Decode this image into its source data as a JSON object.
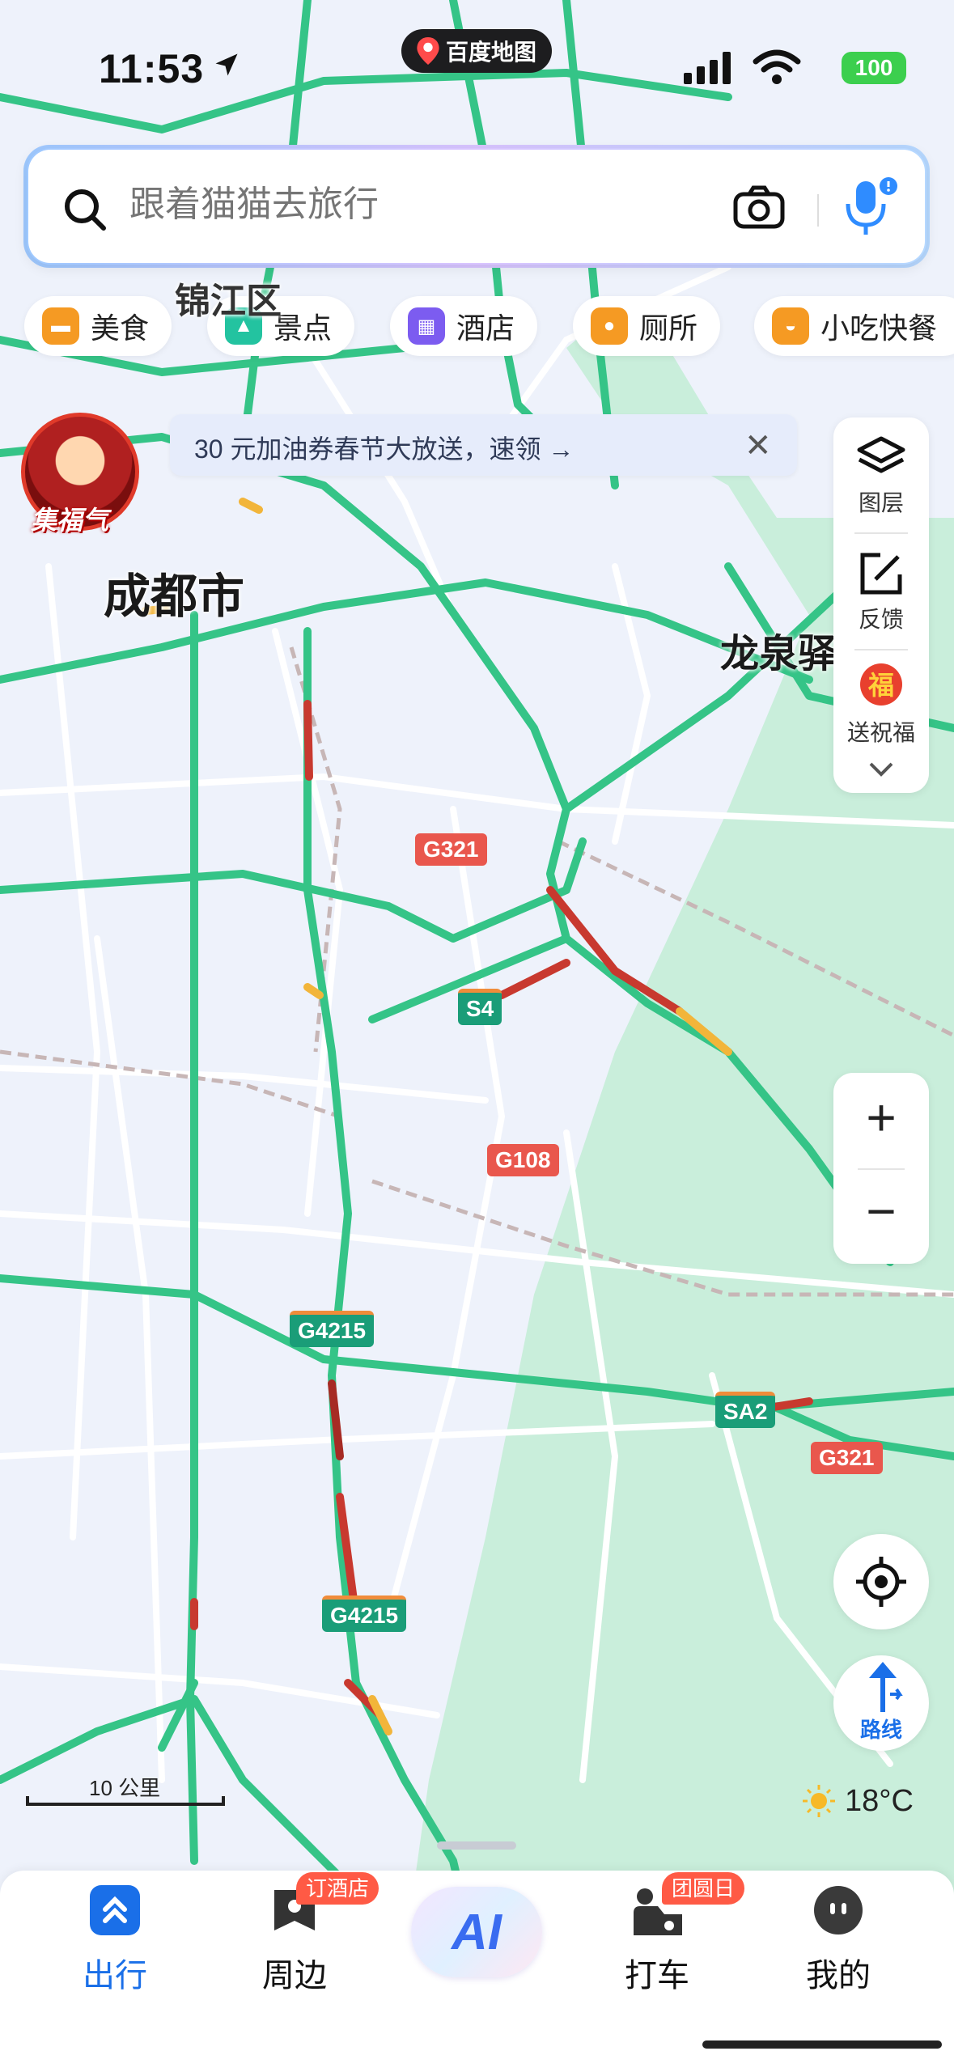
{
  "status": {
    "time": "11:53",
    "app_name": "百度地图",
    "battery": "100"
  },
  "search": {
    "placeholder": "跟着猫猫去旅行"
  },
  "categories": [
    {
      "label": "美食",
      "icon": "food-icon",
      "color": "#f59a23"
    },
    {
      "label": "景点",
      "icon": "scenic-icon",
      "color": "#23c3a0"
    },
    {
      "label": "酒店",
      "icon": "hotel-icon",
      "color": "#7c5cf0"
    },
    {
      "label": "厕所",
      "icon": "toilet-icon",
      "color": "#f59a23"
    },
    {
      "label": "小吃快餐",
      "icon": "snack-icon",
      "color": "#f59a23"
    }
  ],
  "promo": {
    "text": "30 元加油券春节大放送，速领 →",
    "close": "✕"
  },
  "avatar": {
    "label": "集福气"
  },
  "map": {
    "labels": {
      "city": "成都市",
      "district": "锦江区",
      "town": "龙泉驿"
    },
    "shields": {
      "g321_a": "G321",
      "s4": "S4",
      "g108": "G108",
      "g4215_a": "G4215",
      "sa2": "SA2",
      "g321_b": "G321",
      "g4215_b": "G4215"
    }
  },
  "tools": {
    "layers": "图层",
    "feedback": "反馈",
    "blessing": "送祝福"
  },
  "zoom": {
    "in": "+",
    "out": "−"
  },
  "scale": {
    "label": "10 公里"
  },
  "weather": {
    "temp": "18°C"
  },
  "route": {
    "label": "路线"
  },
  "nav": {
    "items": [
      {
        "label": "出行",
        "icon": "travel-icon"
      },
      {
        "label": "周边",
        "icon": "nearby-icon"
      },
      {
        "label": "AI",
        "icon": "ai-icon"
      },
      {
        "label": "打车",
        "icon": "taxi-icon"
      },
      {
        "label": "我的",
        "icon": "profile-icon"
      }
    ],
    "badges": {
      "nearby": "订酒店",
      "taxi": "团圆日"
    }
  },
  "colors": {
    "accent": "#1a6fe8",
    "road": "#35c487",
    "park": "#c4ecd8",
    "jam": "#c8392f",
    "slow": "#f2b53a"
  }
}
